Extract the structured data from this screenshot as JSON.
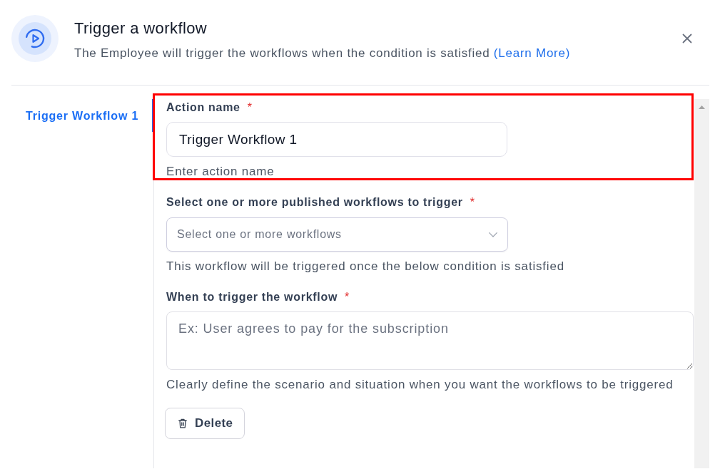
{
  "dialog": {
    "title": "Trigger a workflow",
    "description": "The Employee will trigger the workflows when the condition is satisfied",
    "link": "(Learn More)"
  },
  "sidebar": {
    "items": [
      {
        "label": "Trigger Workflow 1",
        "selected": true
      }
    ]
  },
  "form": {
    "fields": [
      {
        "kind": "text",
        "label": "Action name",
        "required_mark": "*",
        "value": "Trigger Workflow 1",
        "help": "Enter action name",
        "highlighted": true
      },
      {
        "kind": "select",
        "label": "Select one or more published workflows to trigger",
        "required_mark": "*",
        "placeholder": "Select one or more workflows",
        "help": "This workflow will be triggered once the below condition is satisfied",
        "highlighted": false
      },
      {
        "kind": "textarea",
        "label": "When to trigger the workflow",
        "required_mark": "*",
        "placeholder": "Ex: User agrees to pay for the subscription",
        "help": "Clearly define the scenario and situation when you want the workflows to be triggered",
        "highlighted": false
      }
    ],
    "delete_button": {
      "label": "Delete"
    }
  }
}
